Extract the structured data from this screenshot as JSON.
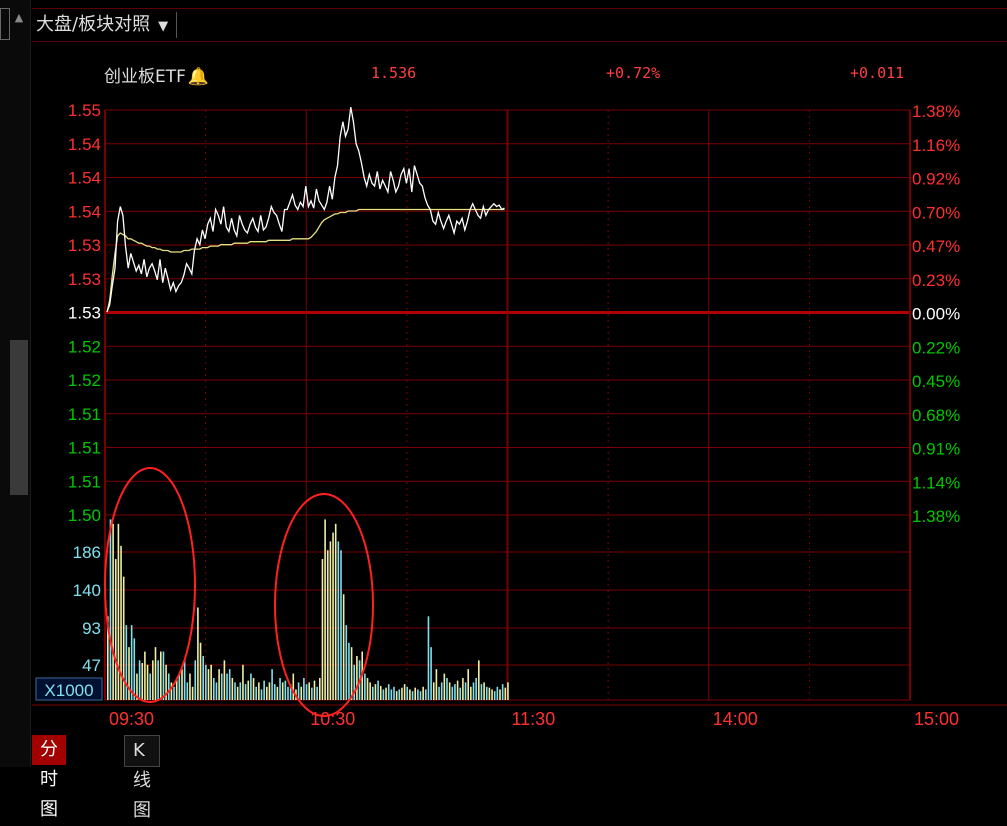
{
  "header": {
    "selector_label": "大盘/板块对照"
  },
  "info": {
    "name": "创业板ETF",
    "price": "1.536",
    "pct": "+0.72%",
    "change": "+0.011"
  },
  "tabs": {
    "intraday": "分时图",
    "kline": "K线图"
  },
  "colors": {
    "up": "#ff3030",
    "down": "#00c800",
    "grid": "#7a0000",
    "price_line": "#ffffff",
    "avg_line": "#e8e080",
    "volume_cyan": "#80e0f0",
    "volume_yellow": "#f0f0a0",
    "annotation": "#ff2020"
  },
  "chart_data": {
    "type": "line",
    "price_axis_labels": [
      "1.55",
      "1.54",
      "1.54",
      "1.54",
      "1.53",
      "1.53",
      "1.53",
      "1.52",
      "1.52",
      "1.51",
      "1.51",
      "1.51",
      "1.50"
    ],
    "pct_axis_labels": [
      "1.38%",
      "1.16%",
      "0.92%",
      "0.70%",
      "0.47%",
      "0.23%",
      "0.00%",
      "0.22%",
      "0.45%",
      "0.68%",
      "0.91%",
      "1.14%",
      "1.38%"
    ],
    "volume_axis_labels": [
      "186",
      "140",
      "93",
      "47"
    ],
    "volume_unit": "X1000",
    "time_labels": [
      "09:30",
      "10:30",
      "11:30",
      "14:00",
      "15:00"
    ],
    "ylim_pct": [
      -1.38,
      1.38
    ],
    "price_pct": [
      0.0,
      0.05,
      0.18,
      0.3,
      0.62,
      0.72,
      0.66,
      0.45,
      0.3,
      0.4,
      0.34,
      0.28,
      0.32,
      0.26,
      0.36,
      0.24,
      0.3,
      0.33,
      0.28,
      0.22,
      0.36,
      0.2,
      0.3,
      0.23,
      0.15,
      0.2,
      0.14,
      0.18,
      0.2,
      0.25,
      0.33,
      0.3,
      0.26,
      0.42,
      0.5,
      0.46,
      0.56,
      0.5,
      0.6,
      0.64,
      0.55,
      0.7,
      0.66,
      0.6,
      0.72,
      0.58,
      0.55,
      0.64,
      0.56,
      0.52,
      0.66,
      0.6,
      0.56,
      0.54,
      0.6,
      0.64,
      0.58,
      0.55,
      0.66,
      0.56,
      0.58,
      0.64,
      0.72,
      0.68,
      0.66,
      0.6,
      0.55,
      0.7,
      0.7,
      0.75,
      0.8,
      0.73,
      0.7,
      0.75,
      0.72,
      0.86,
      0.72,
      0.76,
      0.71,
      0.84,
      0.76,
      0.73,
      0.7,
      0.75,
      0.86,
      0.77,
      0.92,
      1.0,
      1.2,
      1.3,
      1.2,
      1.25,
      1.4,
      1.3,
      1.15,
      1.1,
      1.02,
      0.92,
      0.86,
      0.94,
      0.88,
      0.86,
      0.96,
      0.84,
      0.9,
      0.86,
      0.82,
      0.96,
      0.9,
      0.82,
      0.86,
      0.94,
      0.98,
      0.88,
      0.98,
      0.82,
      1.0,
      0.94,
      0.88,
      0.86,
      0.78,
      0.73,
      0.7,
      0.62,
      0.6,
      0.68,
      0.62,
      0.57,
      0.62,
      0.66,
      0.6,
      0.54,
      0.62,
      0.6,
      0.64,
      0.56,
      0.62,
      0.7,
      0.74,
      0.7,
      0.66,
      0.64,
      0.72,
      0.66,
      0.7,
      0.72,
      0.74,
      0.72,
      0.73,
      0.7,
      0.71
    ],
    "avg_pct": [
      0.0,
      0.08,
      0.25,
      0.4,
      0.52,
      0.54,
      0.53,
      0.52,
      0.5,
      0.5,
      0.49,
      0.48,
      0.47,
      0.47,
      0.46,
      0.45,
      0.45,
      0.44,
      0.44,
      0.43,
      0.43,
      0.42,
      0.42,
      0.42,
      0.41,
      0.41,
      0.41,
      0.41,
      0.41,
      0.42,
      0.42,
      0.42,
      0.43,
      0.43,
      0.43,
      0.43,
      0.44,
      0.44,
      0.44,
      0.45,
      0.45,
      0.45,
      0.45,
      0.46,
      0.46,
      0.46,
      0.46,
      0.46,
      0.47,
      0.47,
      0.47,
      0.47,
      0.47,
      0.47,
      0.48,
      0.48,
      0.48,
      0.48,
      0.48,
      0.48,
      0.48,
      0.49,
      0.49,
      0.49,
      0.49,
      0.49,
      0.49,
      0.49,
      0.49,
      0.49,
      0.5,
      0.5,
      0.5,
      0.5,
      0.5,
      0.5,
      0.5,
      0.51,
      0.53,
      0.55,
      0.58,
      0.61,
      0.63,
      0.64,
      0.65,
      0.66,
      0.67,
      0.67,
      0.68,
      0.68,
      0.68,
      0.69,
      0.69,
      0.69,
      0.69,
      0.7,
      0.7,
      0.7,
      0.7,
      0.7,
      0.7,
      0.7,
      0.7,
      0.7,
      0.7,
      0.7,
      0.7,
      0.7,
      0.7,
      0.7,
      0.7,
      0.7,
      0.7,
      0.7,
      0.7,
      0.7,
      0.7,
      0.7,
      0.7,
      0.7,
      0.7,
      0.7,
      0.7,
      0.7,
      0.7,
      0.7,
      0.7,
      0.7,
      0.7,
      0.7,
      0.7,
      0.7,
      0.7,
      0.7,
      0.7,
      0.7,
      0.7,
      0.7,
      0.7,
      0.7,
      0.7,
      0.7,
      0.7,
      0.7,
      0.7,
      0.7,
      0.7,
      0.7,
      0.7,
      0.7,
      0.7
    ],
    "volume": [
      95,
      205,
      200,
      160,
      200,
      175,
      140,
      85,
      60,
      85,
      70,
      30,
      45,
      42,
      55,
      40,
      30,
      45,
      60,
      45,
      55,
      55,
      40,
      30,
      20,
      15,
      25,
      30,
      35,
      45,
      20,
      30,
      15,
      45,
      105,
      65,
      50,
      40,
      35,
      40,
      25,
      20,
      35,
      30,
      45,
      30,
      35,
      25,
      20,
      15,
      20,
      40,
      18,
      22,
      30,
      25,
      15,
      20,
      12,
      22,
      15,
      20,
      35,
      18,
      15,
      25,
      20,
      22,
      15,
      18,
      30,
      12,
      20,
      15,
      25,
      18,
      20,
      14,
      22,
      15,
      25,
      160,
      205,
      170,
      180,
      190,
      200,
      180,
      170,
      120,
      85,
      65,
      60,
      40,
      50,
      45,
      55,
      30,
      25,
      20,
      15,
      18,
      22,
      16,
      12,
      14,
      18,
      12,
      15,
      10,
      12,
      14,
      18,
      15,
      12,
      10,
      14,
      12,
      10,
      15,
      12,
      95,
      60,
      20,
      35,
      15,
      20,
      30,
      25,
      20,
      15,
      18,
      22,
      14,
      25,
      20,
      35,
      15,
      20,
      25,
      45,
      18,
      20,
      15,
      14,
      12,
      10,
      15,
      12,
      18,
      14,
      20
    ],
    "volume_colors": "ycyyyyycyccycyyycyycycycycycyccyycyyccyyccycyccycycycycycyccyyccycycccyycyccycycyyyyyyyccyccycycycyycycycycccycyycycyccycccyyccycyccycycyyccycycyyccyc",
    "annotations": [
      "ellipse-volume-open",
      "ellipse-volume-1030"
    ]
  }
}
